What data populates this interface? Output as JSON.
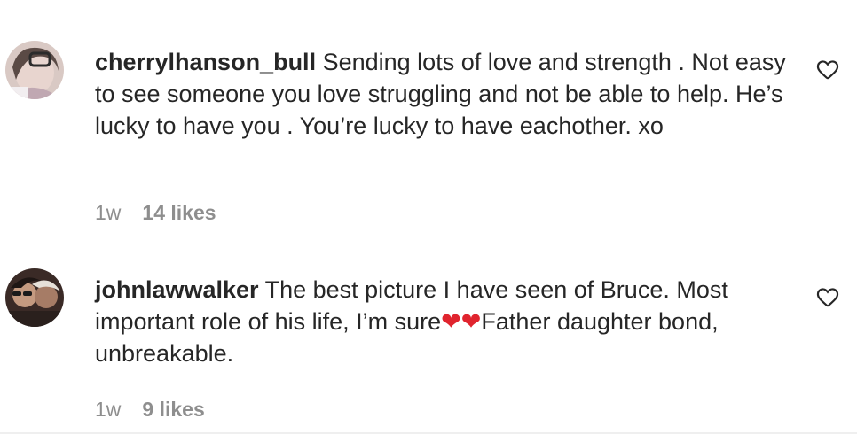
{
  "colors": {
    "text": "#262626",
    "secondary": "#8e8e8e",
    "heart_emoji": "#e0242e"
  },
  "comments": [
    {
      "username": "cherrylhanson_bull",
      "text": "Sending lots of love and strength . Not easy to see someone you love struggling and not be able to help. He’s lucky to have you . You’re lucky to have eachother. xo",
      "time": "1w",
      "likes": "14 likes",
      "like_icon": "heart-outline-icon"
    },
    {
      "username": "johnlawwalker",
      "text_before_emoji": "The best picture I have seen of Bruce. Most important role of his life, I’m sure",
      "emoji": "❤❤",
      "text_after_emoji": "Father daughter bond, unbreakable.",
      "time": "1w",
      "likes": "9 likes",
      "like_icon": "heart-outline-icon"
    }
  ]
}
